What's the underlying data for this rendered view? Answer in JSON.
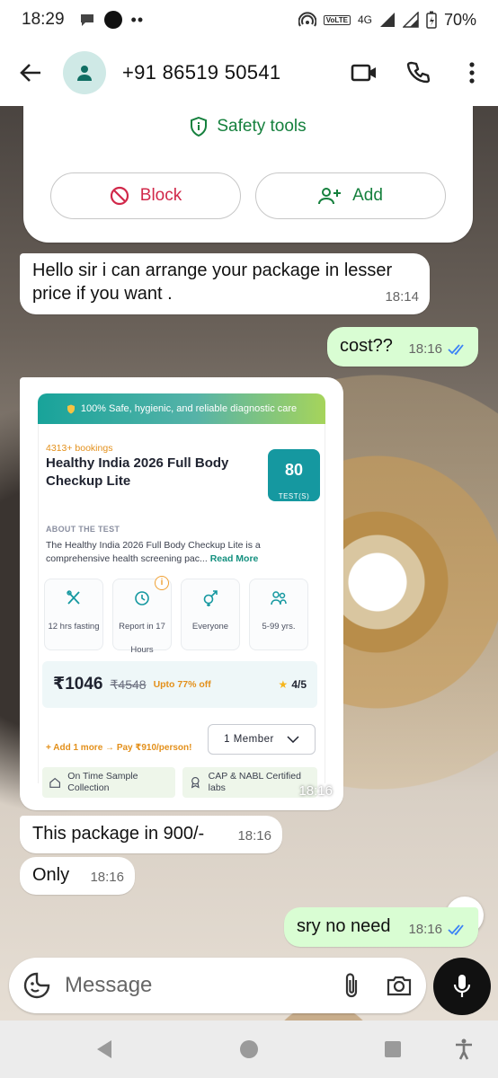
{
  "status_bar": {
    "time": "18:29",
    "volte": "VoLTE",
    "network": "4G",
    "battery": "70%"
  },
  "app_bar": {
    "contact": "+91 86519 50541",
    "icons": [
      "back-arrow-icon",
      "avatar-icon",
      "video-call-icon",
      "phone-icon",
      "more-icon"
    ]
  },
  "safety": {
    "title": "Safety tools",
    "block_label": "Block",
    "add_label": "Add"
  },
  "messages": {
    "m1_text": "Hello sir i can arrange your package in lesser price if you want .",
    "m1_time": "18:14",
    "m2_text": "cost??",
    "m2_time": "18:16",
    "card_time": "18:16",
    "m3_text": "This package in 900/-",
    "m3_time": "18:16",
    "m4_text": "Only",
    "m4_time": "18:16",
    "m5_text": "sry no need",
    "m5_time": "18:16"
  },
  "package_card": {
    "banner": "100% Safe, hygienic, and reliable diagnostic care",
    "bookings": "4313+ bookings",
    "title": "Healthy India 2026 Full Body Checkup Lite",
    "test_count": "80",
    "test_label": "TEST(S)",
    "about_heading": "ABOUT THE TEST",
    "about_text": "The Healthy India 2026 Full Body Checkup Lite is a comprehensive health screening pac...",
    "read_more": "Read More",
    "features": [
      {
        "label": "12 hrs fasting",
        "icon": "fork-knife-icon"
      },
      {
        "label": "Report in 17 Hours",
        "icon": "clock-icon"
      },
      {
        "label": "Everyone",
        "icon": "gender-icon"
      },
      {
        "label": "5-99 yrs.",
        "icon": "people-icon"
      }
    ],
    "price_now": "₹1046",
    "price_old": "₹4548",
    "discount": "Upto 77% off",
    "rating": "4/5",
    "add_more": "+ Add 1 more → Pay ₹910/person!",
    "member": "1 Member",
    "trust1": "On Time Sample Collection",
    "trust2": "CAP & NABL Certified labs"
  },
  "compose": {
    "placeholder": "Message"
  },
  "colors": {
    "accent_green": "#15803d",
    "block_red": "#d1284a",
    "outgoing_bubble": "#d9fdd3",
    "teal": "#1598a0"
  }
}
